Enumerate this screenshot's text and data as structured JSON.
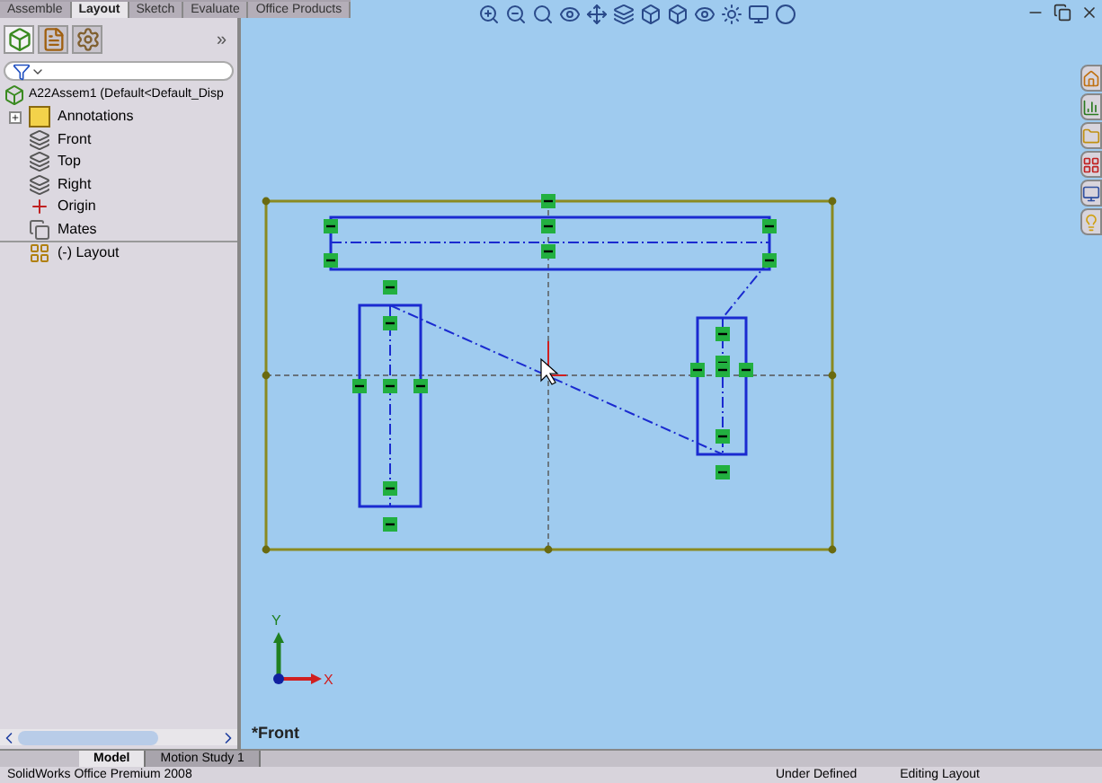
{
  "command_tabs": [
    {
      "label": "Assemble",
      "selected": false
    },
    {
      "label": "Layout",
      "selected": true
    },
    {
      "label": "Sketch",
      "selected": false
    },
    {
      "label": "Evaluate",
      "selected": false
    },
    {
      "label": "Office Products",
      "selected": false
    }
  ],
  "panel_tabs": [
    {
      "kind": "tree",
      "selected": true
    },
    {
      "kind": "properties",
      "selected": false
    },
    {
      "kind": "config",
      "selected": false
    }
  ],
  "panel_expand": "»",
  "tree": {
    "label": "A22Assem1  (Default<Default_Disp",
    "kind": "assembly",
    "children": [
      {
        "label": "Annotations",
        "kind": "annotations",
        "expanded": false
      },
      {
        "label": "Front",
        "kind": "plane"
      },
      {
        "label": "Top",
        "kind": "plane"
      },
      {
        "label": "Right",
        "kind": "plane"
      },
      {
        "label": "Origin",
        "kind": "origin"
      },
      {
        "label": "Mates",
        "kind": "mates"
      },
      {
        "label": "(-) Layout",
        "kind": "layout"
      }
    ]
  },
  "triad": {
    "y": "Y",
    "x": "X"
  },
  "view_label": "*Front",
  "bottom_tabs": [
    {
      "label": "Model",
      "selected": true
    },
    {
      "label": "Motion Study 1",
      "selected": false
    }
  ],
  "status_bar": [
    "SolidWorks Office Premium 2008",
    "Under Defined",
    "Editing Layout"
  ]
}
